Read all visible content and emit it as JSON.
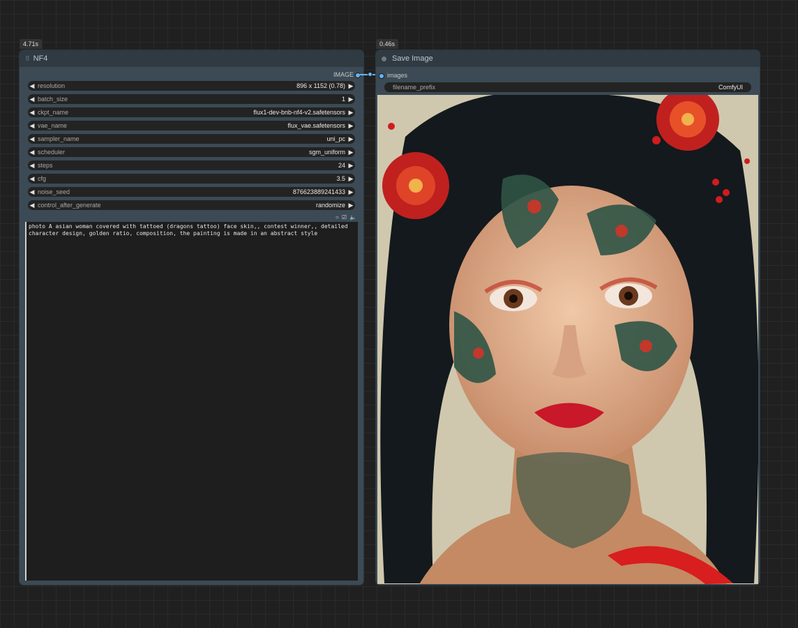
{
  "nodes": {
    "nf4": {
      "badge": "4.71s",
      "title": "NF4",
      "output_label": "IMAGE",
      "widgets": [
        {
          "name": "resolution",
          "value": "896 x 1152 (0.78)"
        },
        {
          "name": "batch_size",
          "value": "1"
        },
        {
          "name": "ckpt_name",
          "value": "flux1-dev-bnb-nf4-v2.safetensors"
        },
        {
          "name": "vae_name",
          "value": "flux_vae.safetensors"
        },
        {
          "name": "sampler_name",
          "value": "uni_pc"
        },
        {
          "name": "scheduler",
          "value": "sgm_uniform"
        },
        {
          "name": "steps",
          "value": "24"
        },
        {
          "name": "cfg",
          "value": "3.5"
        },
        {
          "name": "noise_seed",
          "value": "876623889241433"
        },
        {
          "name": "control_after_generate",
          "value": "randomize"
        }
      ],
      "toolbar_icons": [
        "circle-icon",
        "checkbox-icon",
        "speaker-icon"
      ],
      "prompt": "photo A asian woman covered with tattoed (dragons tattoo) face skin,, contest winner,, detailed character design, golden ratio, composition, the painting is made in an abstract style"
    },
    "save_image": {
      "badge": "0.46s",
      "title": "Save Image",
      "input_label": "images",
      "filename_prefix_label": "filename_prefix",
      "filename_prefix_value": "ComfyUI"
    }
  },
  "icons": {
    "arrow_left": "◀",
    "arrow_right": "▶",
    "grip": "⠿"
  },
  "colors": {
    "link": "#64b5f6",
    "node_header": "#2f3a42",
    "node_body": "#3b4a54",
    "canvas": "#202020"
  }
}
